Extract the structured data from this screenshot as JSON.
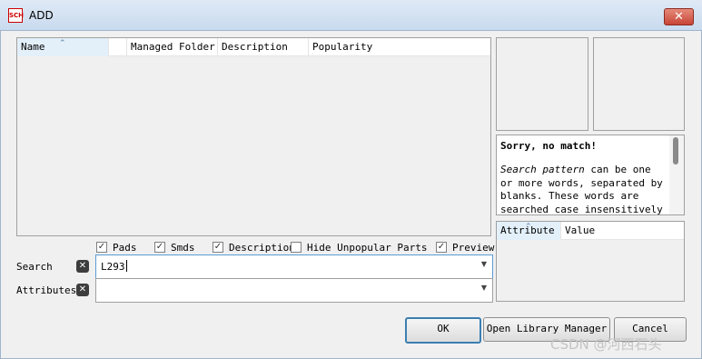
{
  "window": {
    "title": "ADD",
    "icon_text": "SCH",
    "close_glyph": "✕"
  },
  "parts_table": {
    "columns": [
      "Name",
      "Managed Folder",
      "Description",
      "Popularity"
    ],
    "rows": []
  },
  "description": {
    "heading": "Sorry, no match!",
    "text_em": "Search pattern",
    "text_rest": " can be one or more words, separated by blanks. These words are searched case insensitively in"
  },
  "attributes_table": {
    "columns": [
      "Attribute",
      "Value"
    ],
    "rows": []
  },
  "options": [
    {
      "label": "Pads",
      "checked": true
    },
    {
      "label": "Smds",
      "checked": true
    },
    {
      "label": "Description",
      "checked": true
    },
    {
      "label": "Hide Unpopular Parts",
      "checked": false
    },
    {
      "label": "Preview",
      "checked": true
    }
  ],
  "search": {
    "label": "Search",
    "value": "L293"
  },
  "attributes_filter": {
    "label": "Attributes",
    "value": ""
  },
  "buttons": {
    "ok": "OK",
    "library_manager": "Open Library Manager",
    "cancel": "Cancel"
  },
  "watermark": "CSDN @河西石头",
  "glyphs": {
    "check": "✓",
    "clear": "✕",
    "dropdown": "▼",
    "sort_up": "⌃"
  },
  "colors": {
    "title_bar": "#c9dbef",
    "close_button": "#c74536",
    "focus_border": "#3c7fb1"
  }
}
